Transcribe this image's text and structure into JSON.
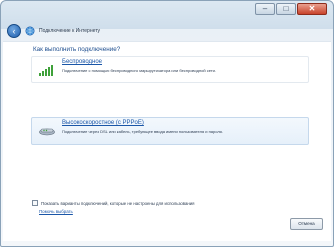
{
  "window": {
    "nav_title": "Подключение к Интернету",
    "buttons": {
      "minimize": "–",
      "maximize": "□",
      "close": "✕"
    }
  },
  "question": "Как выполнить подключение?",
  "options": [
    {
      "title": "Беспроводное",
      "description": "Подключение с помощью беспроводного маршрутизатора или беспроводной сети.",
      "icon": "wireless-signal-icon"
    },
    {
      "title": "Высокоскоростное (с PPPoE)",
      "description": "Подключение через DSL или кабель, требующее ввода имени пользователя и пароля.",
      "icon": "broadband-modem-icon"
    }
  ],
  "show_unconfigured_label": "Показать варианты подключений, которые не настроены для использования",
  "help_link": "Помочь выбрать",
  "cancel_label": "Отмена",
  "colors": {
    "accent": "#1a56a8",
    "signal": "#3fa13a"
  }
}
